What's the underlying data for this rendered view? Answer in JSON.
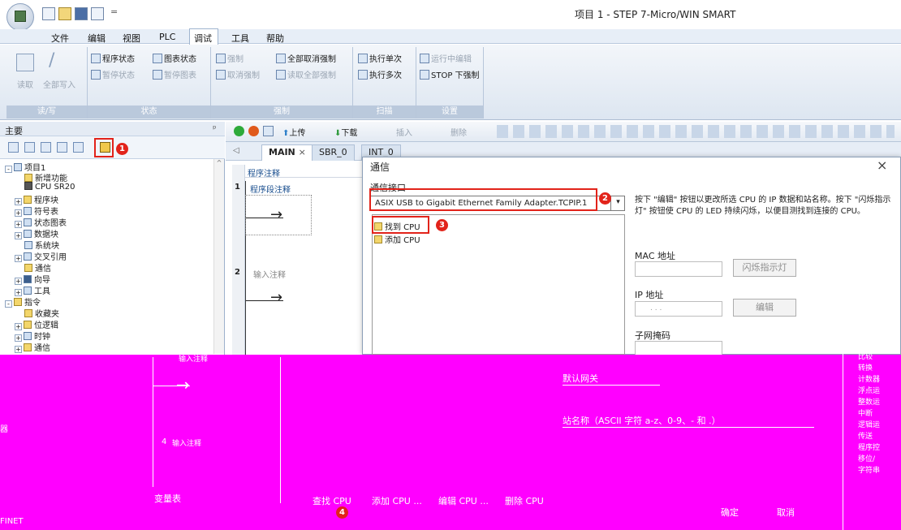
{
  "window": {
    "title": "项目 1 - STEP 7-Micro/WIN SMART",
    "qat_arrow": "="
  },
  "menu": [
    "文件",
    "编辑",
    "视图",
    "PLC",
    "调试",
    "工具",
    "帮助"
  ],
  "ribbon": {
    "g1": {
      "label": "读/写",
      "b1": "读取",
      "b2": "全部写入"
    },
    "g2": {
      "label": "状态",
      "i1": "程序状态",
      "i2": "图表状态",
      "i3": "暂停状态",
      "i4": "暂停图表"
    },
    "g3": {
      "label": "强制",
      "i1": "强制",
      "i2": "全部取消强制",
      "i3": "取消强制",
      "i4": "读取全部强制"
    },
    "g4": {
      "label": "扫描",
      "i1": "执行单次",
      "i2": "执行多次"
    },
    "g5": {
      "label": "设置",
      "i1": "运行中编辑",
      "i2": "STOP 下强制"
    }
  },
  "left": {
    "header": "主要",
    "pin": "ᵖ",
    "tree": [
      "项目1",
      "新增功能",
      "CPU SR20",
      "程序块",
      "符号表",
      "状态图表",
      "数据块",
      "系统块",
      "交叉引用",
      "通信",
      "向导",
      "工具",
      "指令",
      "收藏夹",
      "位逻辑",
      "时钟",
      "通信"
    ]
  },
  "editor": {
    "toolbar": {
      "upload": "上传",
      "download": "下载",
      "insert": "插入",
      "delete": "删除"
    },
    "tabs": [
      "MAIN",
      "SBR_0",
      "INT_0"
    ],
    "tab_close": "×",
    "prog_comment": "程序注释",
    "net1": "1",
    "net1_comment": "程序段注释",
    "net2": "2",
    "net2_comment": "输入注释"
  },
  "dialog": {
    "title": "通信",
    "close": "×",
    "iface_label": "通信接口",
    "iface_value": "ASIX USB to Gigabit Ethernet Family Adapter.TCPIP.1",
    "arrow": "▾",
    "find_cpu": "找到 CPU",
    "add_cpu": "添加 CPU",
    "hint": "按下 \"编辑\" 按钮以更改所选 CPU 的 IP 数据和站名称。按下 \"闪烁指示灯\" 按钮使 CPU 的 LED 持续闪烁，以便目测找到连接的 CPU。",
    "mac_label": "MAC 地址",
    "blink_btn": "闪烁指示灯",
    "ip_label": "IP 地址",
    "ip_dots": ".     .     .",
    "edit_btn": "编辑",
    "subnet_label": "子网掩码",
    "gateway_label": "默认网关",
    "station_label": "站名称（ASCII 字符 a-z、0-9、- 和 .）",
    "btn_find": "查找 CPU",
    "btn_add": "添加 CPU ...",
    "btn_edit": "编辑 CPU ...",
    "btn_delete": "删除 CPU",
    "ok": "确定",
    "cancel": "取消"
  },
  "glitch": {
    "net3_comment": "输入注释",
    "net4": "4",
    "net4_comment": "输入注释",
    "var_table": "变量表",
    "left_tail": "器",
    "finet": "FINET",
    "right_items": [
      "比较",
      "转换",
      "计数器",
      "浮点运",
      "整数运",
      "中断",
      "逻辑运",
      "传送",
      "程序控",
      "移位/",
      "字符串"
    ]
  },
  "badges": [
    "1",
    "2",
    "3",
    "4"
  ],
  "colors": {
    "annotation": "#e2231a",
    "corrupt": "#ff00ff"
  }
}
